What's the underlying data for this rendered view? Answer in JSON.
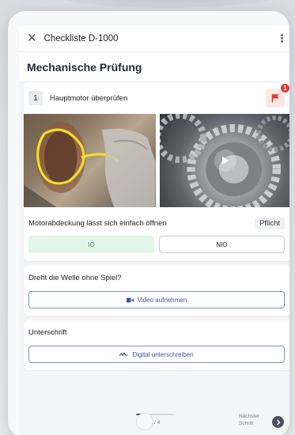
{
  "appbar": {
    "title": "Checkliste D-1000",
    "close_icon": "close-icon",
    "menu_icon": "kebab-menu-icon"
  },
  "section": {
    "title": "Mechanische Prüfung"
  },
  "task": {
    "number": "1",
    "label": "Hauptmotor überprüfen",
    "flag_count": "1",
    "flag_color": "#e53935"
  },
  "media": [
    {
      "name": "motor-winding-photo"
    },
    {
      "name": "gear-video-thumbnail",
      "icon": "play-icon"
    }
  ],
  "question1": {
    "label": "Motorabdeckung lässt sich einfach öffnen",
    "badge": "Pflicht",
    "options": [
      "IO",
      "NIO"
    ],
    "selected": "IO"
  },
  "question2": {
    "label": "Dreht die Welle ohne Spiel?",
    "button_label": "Video aufnehmen",
    "button_icon": "video-camera-icon"
  },
  "signature": {
    "label": "Unterschrift",
    "button_label": "Digital unterschreiben",
    "button_icon": "signature-icon"
  },
  "footer": {
    "progress_text": "1 / 4",
    "progress_fraction": 0.25,
    "next_line1": "Nächster",
    "next_line2": "Schritt"
  },
  "colors": {
    "accent": "#3a55a6",
    "success_bg": "#e3f4e8",
    "success_text": "#3f8a55",
    "danger": "#e53935"
  }
}
